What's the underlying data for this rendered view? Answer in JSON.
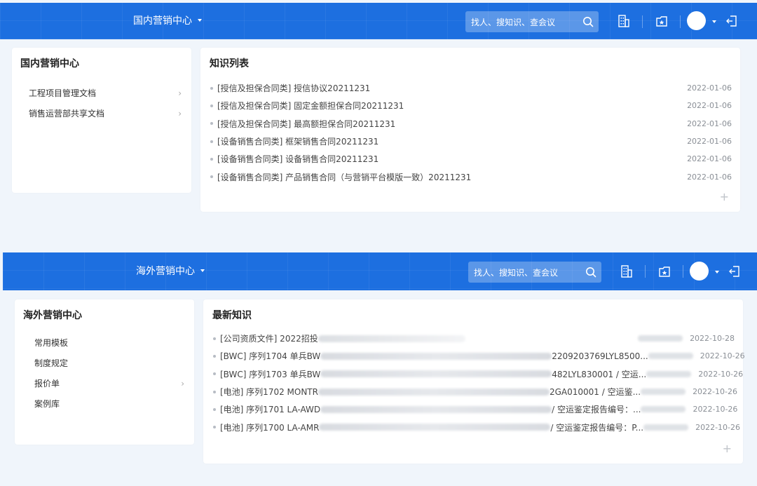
{
  "panels": [
    {
      "topbar": {
        "center_title": "国内营销中心",
        "search_placeholder": "找人、搜知识、查会议"
      },
      "sidebar": {
        "title": "国内营销中心",
        "items": [
          {
            "label": "工程项目管理文档",
            "chevron": true
          },
          {
            "label": "销售运营部共享文档",
            "chevron": true
          }
        ]
      },
      "main": {
        "title": "知识列表",
        "items": [
          {
            "title": "[授信及担保合同类] 授信协议20211231",
            "date": "2022-01-06"
          },
          {
            "title": "[授信及担保合同类] 固定金额担保合同20211231",
            "date": "2022-01-06"
          },
          {
            "title": "[授信及担保合同类] 最高额担保合同20211231",
            "date": "2022-01-06"
          },
          {
            "title": "[设备销售合同类] 框架销售合同20211231",
            "date": "2022-01-06"
          },
          {
            "title": "[设备销售合同类] 设备销售合同20211231",
            "date": "2022-01-06"
          },
          {
            "title": "[设备销售合同类] 产品销售合同（与营销平台模版一致）20211231",
            "date": "2022-01-06"
          }
        ]
      }
    },
    {
      "topbar": {
        "center_title": "海外营销中心",
        "search_placeholder": "找人、搜知识、查会议"
      },
      "sidebar": {
        "title": "海外营销中心",
        "items": [
          {
            "label": "常用模板",
            "chevron": false
          },
          {
            "label": "制度规定",
            "chevron": false
          },
          {
            "label": "报价单",
            "chevron": true
          },
          {
            "label": "案例库",
            "chevron": false
          }
        ]
      },
      "main": {
        "title": "最新知识",
        "items": [
          {
            "title": "[公司资质文件] 2022招投",
            "tail": "",
            "date": "2022-10-28"
          },
          {
            "title": "[BWC] 序列1704 单兵BW",
            "tail": "2209203769LYL8500...",
            "date": "2022-10-26"
          },
          {
            "title": "[BWC] 序列1703 单兵BW",
            "tail": "482LYL830001 / 空运...",
            "date": "2022-10-26"
          },
          {
            "title": "[电池] 序列1702 MONTR",
            "tail": "2GA010001 / 空运鉴...",
            "date": "2022-10-26"
          },
          {
            "title": "[电池] 序列1701 LA-AWD",
            "tail": "/ 空运鉴定报告编号：...",
            "date": "2022-10-26"
          },
          {
            "title": "[电池] 序列1700 LA-AMR",
            "tail": "/ 空运鉴定报告编号：P...",
            "date": "2022-10-26"
          }
        ]
      }
    }
  ],
  "icons": {
    "search": "search-icon",
    "building": "building-icon",
    "star_folder": "star-folder-icon",
    "logout": "logout-icon",
    "add": "plus-icon"
  },
  "colors": {
    "topbar": "#1d6fe0",
    "background": "#f0f5fb"
  }
}
